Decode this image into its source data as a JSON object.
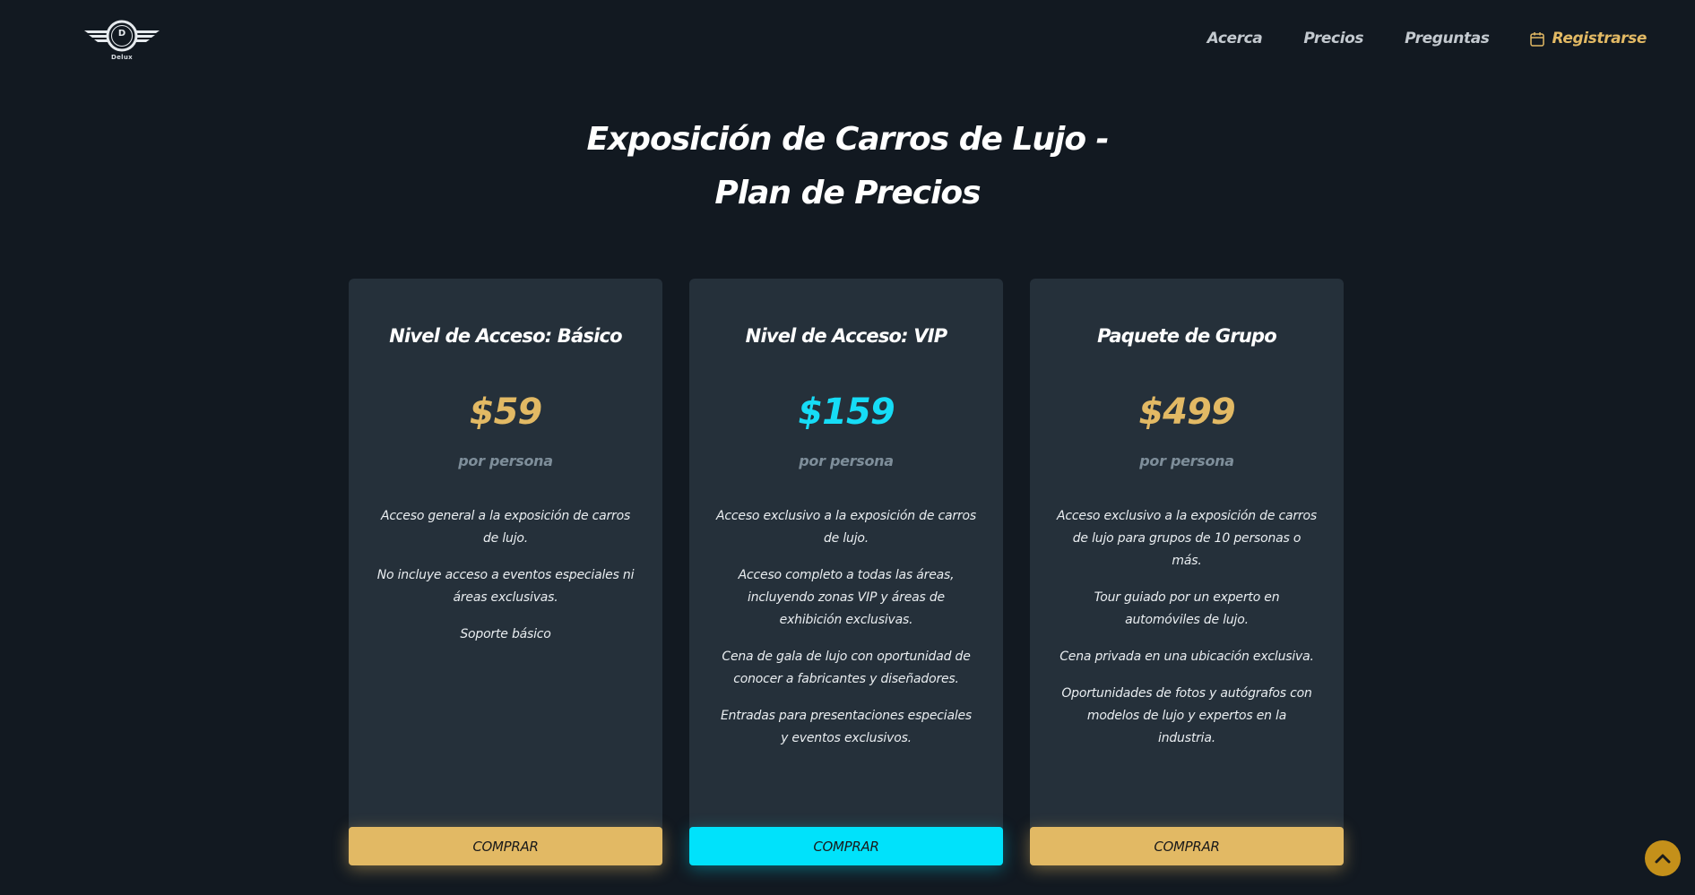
{
  "logo": {
    "letter": "D",
    "text": "Delux",
    "icon": "winged-wheel-logo"
  },
  "nav": {
    "about": "Acerca",
    "pricing": "Precios",
    "faq": "Preguntas",
    "register": "Registrarse",
    "register_icon": "calendar-icon"
  },
  "title": {
    "line1": "Exposición de Carros de Lujo -",
    "line2": "Plan de Precios"
  },
  "plans": [
    {
      "name": "Nivel de Acceso: Básico",
      "price": "$59",
      "period": "por persona",
      "features": [
        "Acceso general a la exposición de carros de lujo.",
        "No incluye acceso a eventos especiales ni áreas exclusivas.",
        "Soporte básico"
      ],
      "button": "COMPRAR",
      "accent": "#e2b964"
    },
    {
      "name": "Nivel de Acceso: VIP",
      "price": "$159",
      "period": "por persona",
      "features": [
        "Acceso exclusivo a la exposición de carros de lujo.",
        "Acceso completo a todas las áreas, incluyendo zonas VIP y áreas de exhibición exclusivas.",
        "Cena de gala de lujo con oportunidad de conocer a fabricantes y diseñadores.",
        "Entradas para presentaciones especiales y eventos exclusivos."
      ],
      "button": "COMPRAR",
      "accent": "#00e2fb"
    },
    {
      "name": "Paquete de Grupo",
      "price": "$499",
      "period": "por persona",
      "features": [
        "Acceso exclusivo a la exposición de carros de lujo para grupos de 10 personas o más.",
        "Tour guiado por un experto en automóviles de lujo.",
        "Cena privada en una ubicación exclusiva.",
        "Oportunidades de fotos y autógrafos con modelos de lujo y expertos en la industria."
      ],
      "button": "COMPRAR",
      "accent": "#e2b964"
    }
  ],
  "scroll_top_icon": "chevron-up-icon",
  "colors": {
    "background": "#121921",
    "card": "#25303a",
    "gold": "#e2b964",
    "cyan": "#00e2fb",
    "muted": "#7e8e9a"
  }
}
